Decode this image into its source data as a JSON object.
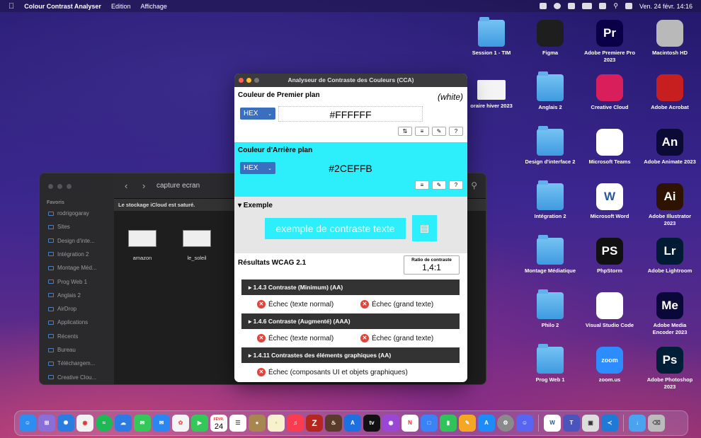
{
  "menubar": {
    "app": "Colour Contrast Analyser",
    "items": [
      "Edition",
      "Affichage"
    ],
    "datetime": "Ven. 24 févr.  14:16"
  },
  "desktop_icons": [
    {
      "label": "Session 1 - TIM",
      "kind": "folder"
    },
    {
      "label": "Figma",
      "kind": "app",
      "text": "",
      "color": "#1e1e1e"
    },
    {
      "label": "Adobe Premiere Pro 2023",
      "kind": "app",
      "text": "Pr",
      "color": "#0a0048"
    },
    {
      "label": "Macintosh HD",
      "kind": "app",
      "text": "",
      "color": "#b9b9b9"
    },
    {
      "label": "oraire hiver 2023",
      "kind": "doc"
    },
    {
      "label": "Anglais 2",
      "kind": "folder"
    },
    {
      "label": "Creative Cloud",
      "kind": "app",
      "text": "",
      "color": "#d81e5b"
    },
    {
      "label": "Adobe Acrobat",
      "kind": "app",
      "text": "",
      "color": "#c71f1f"
    },
    {
      "label": "Design d'interface 2",
      "kind": "folder"
    },
    {
      "label": "Microsoft Teams",
      "kind": "app",
      "text": "",
      "color": "#ffffff"
    },
    {
      "label": "Adobe Animate 2023",
      "kind": "app",
      "text": "An",
      "color": "#0b0a34"
    },
    {
      "label": "Intégration 2",
      "kind": "folder"
    },
    {
      "label": "Microsoft Word",
      "kind": "app",
      "text": "W",
      "color": "#ffffff"
    },
    {
      "label": "Adobe Illustrator 2023",
      "kind": "app",
      "text": "Ai",
      "color": "#2e1300"
    },
    {
      "label": "Montage Médiatique",
      "kind": "folder"
    },
    {
      "label": "PhpStorm",
      "kind": "app",
      "text": "PS",
      "color": "#111111"
    },
    {
      "label": "Adobe Lightroom",
      "kind": "app",
      "text": "Lr",
      "color": "#001b33"
    },
    {
      "label": "Philo 2",
      "kind": "folder"
    },
    {
      "label": "Visual Studio Code",
      "kind": "app",
      "text": "",
      "color": "#ffffff"
    },
    {
      "label": "Adobe Media Encoder 2023",
      "kind": "app",
      "text": "Me",
      "color": "#0a0838"
    },
    {
      "label": "Prog Web 1",
      "kind": "folder"
    },
    {
      "label": "zoom.us",
      "kind": "app",
      "text": "zoom",
      "color": "#2d8cff"
    },
    {
      "label": "Adobe Photoshop 2023",
      "kind": "app",
      "text": "Ps",
      "color": "#001e36"
    }
  ],
  "finder": {
    "path": "capture ecran",
    "favorites_header": "Favoris",
    "sidebar": [
      "rodrigogaray",
      "Sites",
      "Design d'inte...",
      "Intégration 2",
      "Montage Méd...",
      "Prog Web 1",
      "Anglais 2",
      "AirDrop",
      "Applications",
      "Récents",
      "Bureau",
      "Téléchargem...",
      "Creative Clou..."
    ],
    "notice": "Le stockage iCloud est saturé.",
    "files": [
      "amazon",
      "le_soleil"
    ]
  },
  "cca": {
    "title": "Analyseur de Contraste des Couleurs (CCA)",
    "foreground": {
      "heading": "Couleur de Premier plan",
      "name": "(white)",
      "format": "HEX",
      "value": "#FFFFFF"
    },
    "background": {
      "heading": "Couleur d'Arrière plan",
      "format": "HEX",
      "value": "#2CEFFB",
      "color": "#2CEFFB"
    },
    "example": {
      "heading": "▾ Exemple",
      "text": "exemple de contraste texte"
    },
    "results": {
      "heading": "Résultats WCAG 2.1",
      "ratio_label": "Ratio de contraste",
      "ratio_value": "1,4:1",
      "criteria": [
        {
          "title": "▸ 1.4.3 Contraste (Minimum) (AA)",
          "fails": [
            "Échec (texte normal)",
            "Échec (grand texte)"
          ]
        },
        {
          "title": "▸ 1.4.6 Contraste (Augmenté) (AAA)",
          "fails": [
            "Échec (texte normal)",
            "Échec (grand texte)"
          ]
        },
        {
          "title": "▸ 1.4.11 Contrastes des éléments graphiques (AA)",
          "fails": [
            "Échec (composants UI et objets graphiques)"
          ]
        }
      ]
    }
  },
  "dock": {
    "calendar_month": "FÉVR.",
    "calendar_day": "24"
  }
}
